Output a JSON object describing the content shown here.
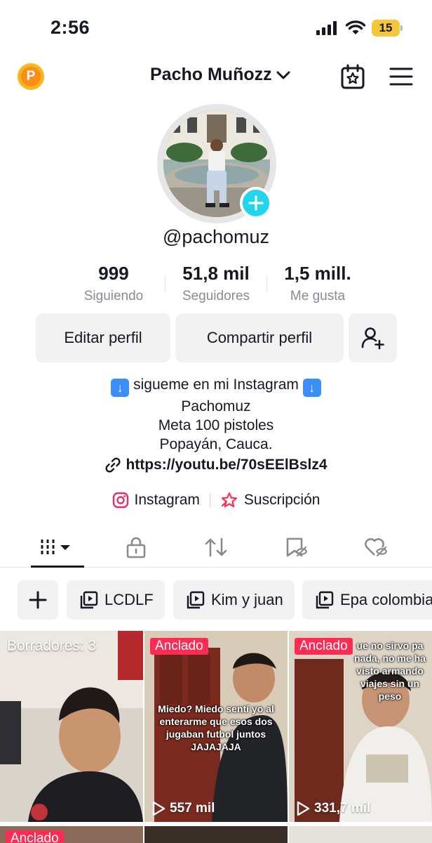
{
  "status_bar": {
    "time": "2:56",
    "battery": "15"
  },
  "header": {
    "coin_letter": "P",
    "profile_name": "Pacho Muñozz"
  },
  "profile": {
    "username": "@pachomuz"
  },
  "stats": [
    {
      "value": "999",
      "label": "Siguiendo"
    },
    {
      "value": "51,8 mil",
      "label": "Seguidores"
    },
    {
      "value": "1,5 mill.",
      "label": "Me gusta"
    }
  ],
  "buttons": {
    "edit": "Editar perfil",
    "share": "Compartir perfil"
  },
  "bio": {
    "line1": "sigueme en mi Instagram",
    "line2": "Pachomuz",
    "line3": "Meta 100 pistoles",
    "line4": "Popayán, Cauca.",
    "link": "https://youtu.be/70sEElBslz4"
  },
  "social": {
    "instagram": "Instagram",
    "subscription": "Suscripción"
  },
  "playlists": [
    {
      "label": "LCDLF"
    },
    {
      "label": "Kim y juan"
    },
    {
      "label": "Epa colombia"
    }
  ],
  "videos": [
    {
      "overlay": "Borradores: 3"
    },
    {
      "badge": "Anclado",
      "caption": "Miedo? Miedo sentí yo al enterarme que esos dos jugaban futbol juntos JAJAJAJA",
      "views": "557 mil"
    },
    {
      "badge": "Anclado",
      "caption": "ue no sirvo pa nada, no me ha visto armando viajes sin un peso",
      "views": "331,7 mil"
    }
  ],
  "row2_badge": "Anclado",
  "colors": {
    "accent": "#fe2c55",
    "add_button": "#20d5ec",
    "coin": "#f7b61c",
    "battery": "#f4c63a"
  }
}
